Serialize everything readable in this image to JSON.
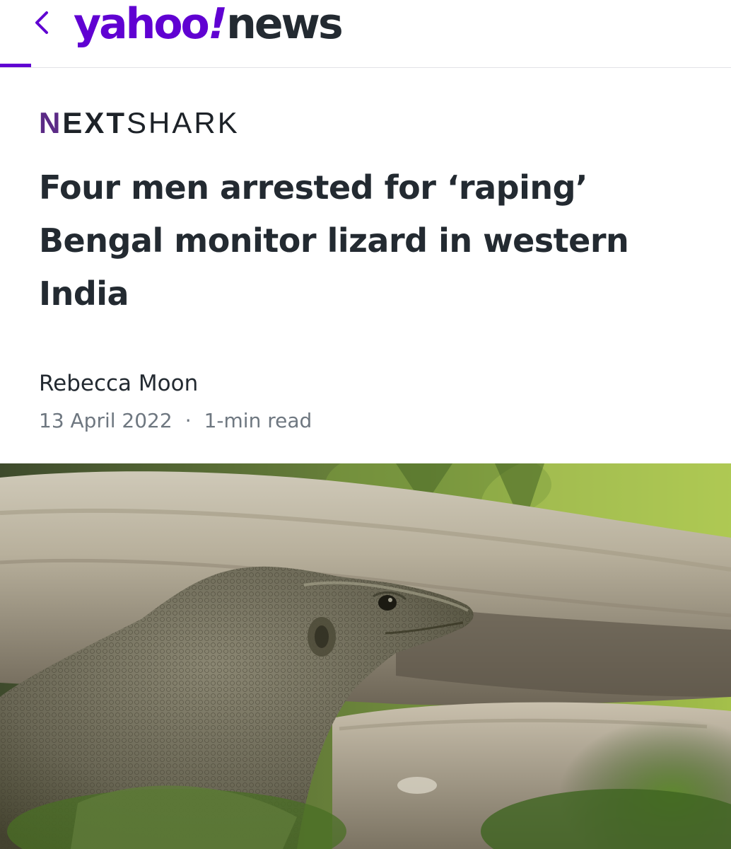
{
  "header": {
    "back_icon": "chevron-left-icon",
    "logo_yahoo": "yahoo",
    "logo_bang": "!",
    "logo_news": "news",
    "accent_color": "#6001d2"
  },
  "article": {
    "publisher": {
      "first": "N",
      "bold": "EXT",
      "rest": "SHARK"
    },
    "headline": "Four men arrested for ‘raping’ Bengal monitor lizard in western India",
    "author": "Rebecca Moon",
    "date": "13 April 2022",
    "separator": "·",
    "read_time": "1-min read"
  },
  "hero_image": {
    "subject": "bengal-monitor-lizard-photo"
  }
}
